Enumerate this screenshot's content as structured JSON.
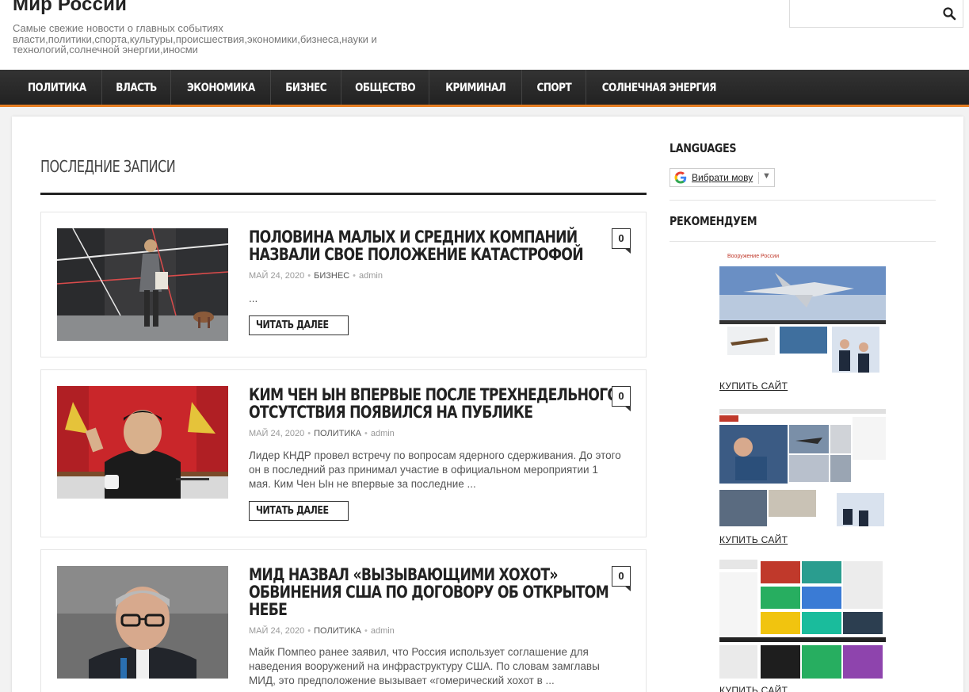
{
  "site": {
    "title": "Мир России",
    "description": "Самые свежие новости о главных событиях власти,политики,спорта,культуры,происшествия,экономики,бизнеса,науки и технологий,солнечной энергии,иносми"
  },
  "search": {
    "placeholder": "",
    "icon": "search-icon"
  },
  "nav": {
    "items": [
      {
        "label": "ПОЛИТИКА"
      },
      {
        "label": "ВЛАСТЬ"
      },
      {
        "label": "ЭКОНОМИКА"
      },
      {
        "label": "БИЗНЕС"
      },
      {
        "label": "ОБЩЕСТВО"
      },
      {
        "label": "КРИМИНАЛ"
      },
      {
        "label": "СПОРТ"
      },
      {
        "label": "СОЛНЕЧНАЯ ЭНЕРГИЯ"
      }
    ]
  },
  "main": {
    "section_title": "ПОСЛЕДНИЕ ЗАПИСИ",
    "read_more_label": "ЧИТАТЬ ДАЛЕЕ",
    "posts": [
      {
        "title_lines": [
          "ПОЛОВИНА МАЛЫХ И СРЕДНИХ КОМПАНИЙ",
          "НАЗВАЛИ СВОЕ ПОЛОЖЕНИЕ КАТАСТРОФОЙ"
        ],
        "date": "МАЙ 24, 2020",
        "category": "БИЗНЕС",
        "author": "admin",
        "excerpt": "...",
        "comments": "0"
      },
      {
        "title_lines": [
          "КИМ ЧЕН ЫН ВПЕРВЫЕ ПОСЛЕ ТРЕХНЕДЕЛЬНОГО",
          "ОТСУТСТВИЯ ПОЯВИЛСЯ НА ПУБЛИКЕ"
        ],
        "date": "МАЙ 24, 2020",
        "category": "ПОЛИТИКА",
        "author": "admin",
        "excerpt": "Лидер КНДР провел встречу по вопросам ядерного сдерживания. До этого он в последний раз принимал участие в официальном мероприятии 1 мая. Ким Чен Ын не впервые за последние ...",
        "comments": "0"
      },
      {
        "title_lines": [
          "МИД НАЗВАЛ «ВЫЗЫВАЮЩИМИ ХОХОТ»",
          "ОБВИНЕНИЯ США ПО ДОГОВОРУ ОБ ОТКРЫТОМ",
          "НЕБЕ"
        ],
        "date": "МАЙ 24, 2020",
        "category": "ПОЛИТИКА",
        "author": "admin",
        "excerpt": "Майк Помпео ранее заявил, что Россия использует соглашение для наведения вооружений на инфраструктуру США. По словам замглавы МИД, это предположение вызывает «гомерический хохот в ...",
        "comments": "0"
      }
    ]
  },
  "sidebar": {
    "languages_title": "LANGUAGES",
    "translate_label": "Вибрати мову",
    "recommend_title": "РЕКОМЕНДУЕМ",
    "buy_label": "КУПИТЬ САЙТ",
    "promo1_brand": "Вооружение России"
  },
  "colors": {
    "accent": "#e67e22",
    "nav_bg": "#2b2b2b"
  }
}
